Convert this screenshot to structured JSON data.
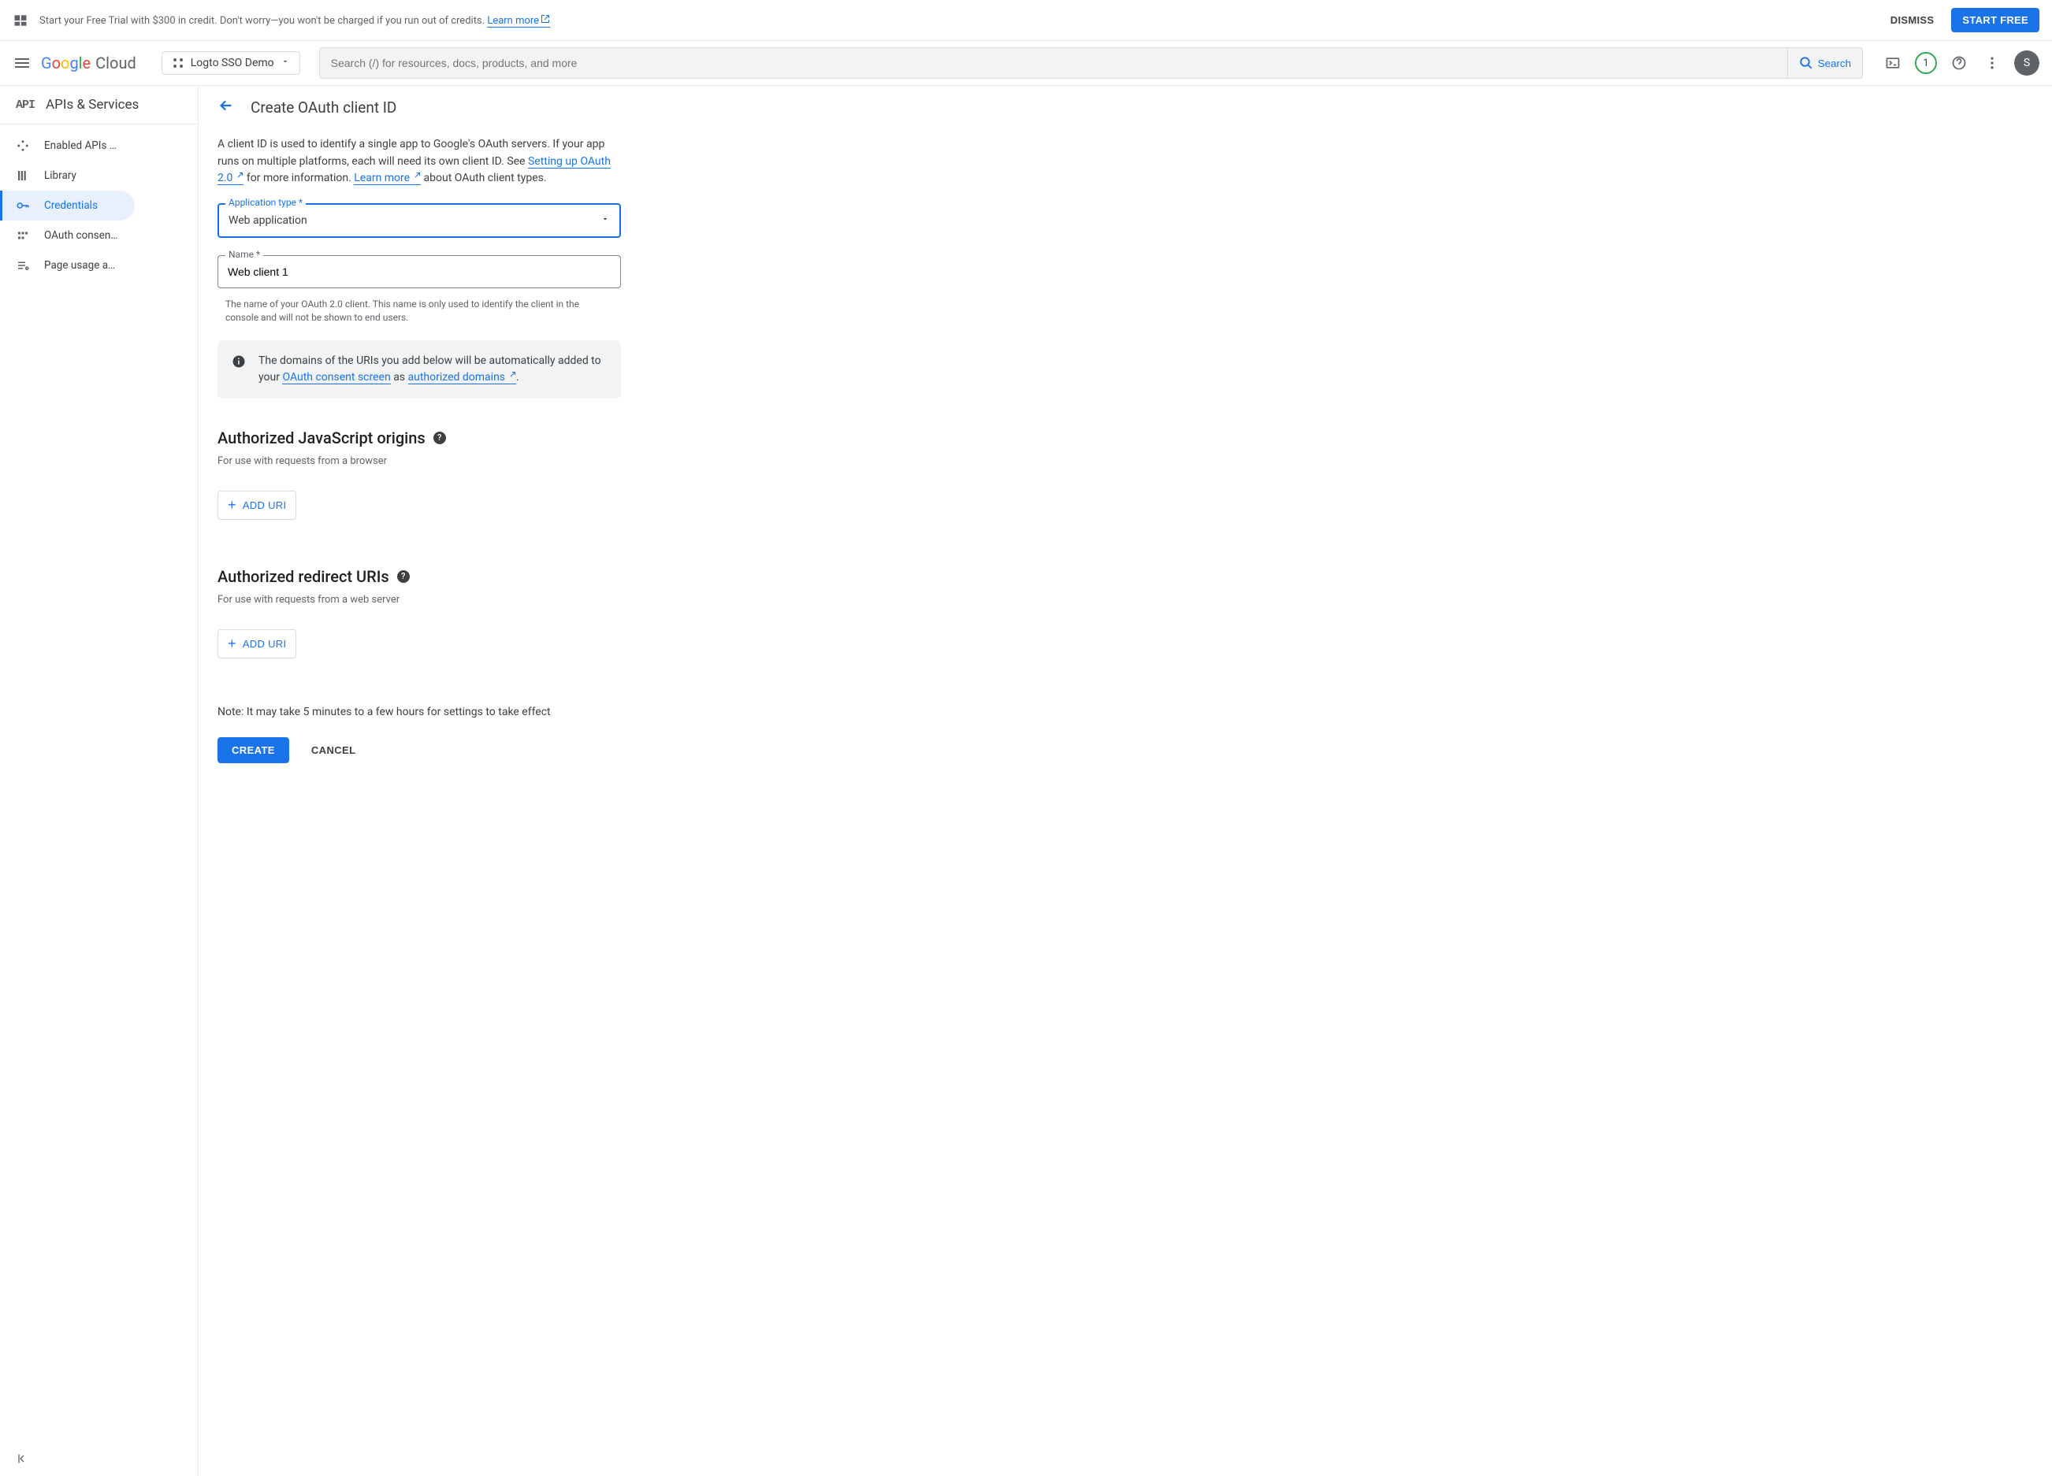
{
  "banner": {
    "message_prefix": "Start your Free Trial with $300 in credit. Don't worry—you won't be charged if you run out of credits. ",
    "learn_more": "Learn more",
    "dismiss": "DISMISS",
    "start_free": "START FREE"
  },
  "header": {
    "logo_cloud": "Cloud",
    "project_name": "Logto SSO Demo",
    "search_placeholder": "Search (/) for resources, docs, products, and more",
    "search_button": "Search",
    "badge_count": "1",
    "avatar_initial": "S"
  },
  "sidebar": {
    "api_label": "API",
    "title": "APIs & Services",
    "items": [
      {
        "label": "Enabled APIs …"
      },
      {
        "label": "Library"
      },
      {
        "label": "Credentials"
      },
      {
        "label": "OAuth consen…"
      },
      {
        "label": "Page usage a…"
      }
    ]
  },
  "page": {
    "title": "Create OAuth client ID",
    "intro": {
      "part1": "A client ID is used to identify a single app to Google's OAuth servers. If your app runs on multiple platforms, each will need its own client ID. See ",
      "link1": "Setting up OAuth 2.0",
      "part2": " for more information. ",
      "link2": "Learn more",
      "part3": " about OAuth client types."
    },
    "fields": {
      "app_type_label": "Application type *",
      "app_type_value": "Web application",
      "name_label": "Name *",
      "name_value": "Web client 1",
      "name_helper": "The name of your OAuth 2.0 client. This name is only used to identify the client in the console and will not be shown to end users."
    },
    "info_box": {
      "part1": "The domains of the URIs you add below will be automatically added to your ",
      "link1": "OAuth consent screen",
      "part2": " as ",
      "link2": "authorized domains",
      "part3": "."
    },
    "sections": {
      "js_origins": {
        "title": "Authorized JavaScript origins",
        "subtitle": "For use with requests from a browser",
        "add_btn": "ADD URI"
      },
      "redirect_uris": {
        "title": "Authorized redirect URIs",
        "subtitle": "For use with requests from a web server",
        "add_btn": "ADD URI"
      }
    },
    "note": "Note: It may take 5 minutes to a few hours for settings to take effect",
    "create_btn": "CREATE",
    "cancel_btn": "CANCEL"
  }
}
